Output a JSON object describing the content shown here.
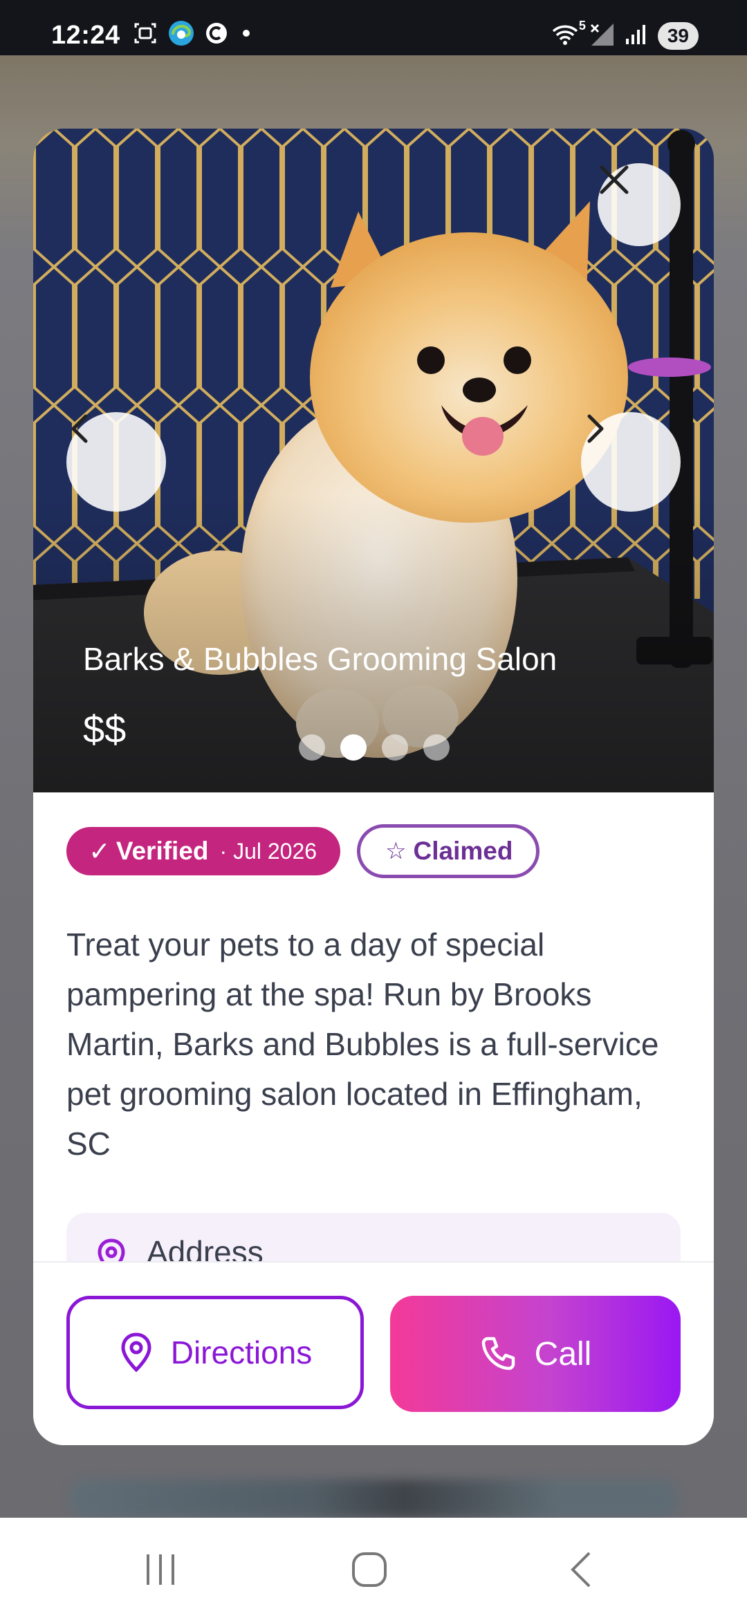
{
  "status_bar": {
    "time": "12:24",
    "left_icons": [
      "screenshot-icon",
      "edge-browser-icon",
      "c-app-icon",
      "notification-dot-icon"
    ],
    "right_icons": [
      "wifi-icon",
      "no-signal-icon",
      "signal-bars-icon"
    ],
    "wifi_label": "5",
    "battery": "39"
  },
  "listing": {
    "name": "Barks & Bubbles Grooming Salon",
    "price": "$$",
    "gallery": {
      "total": 4,
      "active_index": 1
    },
    "verified_label": "Verified",
    "verified_check": "✓",
    "verified_date": "· Jul 2026",
    "claimed_label": "Claimed",
    "claimed_star": "☆",
    "description": "Treat your pets to a day of special pampering at the spa! Run by Brooks Martin, Barks and Bubbles is a full-service pet grooming salon located in Effingham, SC",
    "address_label": "Address"
  },
  "actions": {
    "directions": "Directions",
    "call": "Call"
  },
  "colors": {
    "accent_purple": "#8b17d6",
    "verified_pink": "#c4257e",
    "claimed_purple": "#8a4bb0",
    "call_gradient": [
      "#f33a98",
      "#9a18f2"
    ]
  }
}
